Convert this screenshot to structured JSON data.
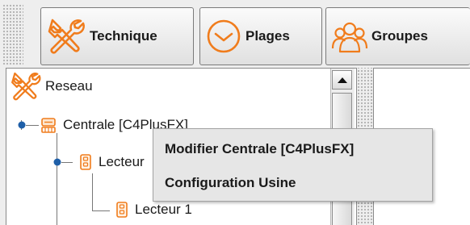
{
  "toolbar": {
    "buttons": [
      {
        "label": "Technique",
        "icon": "wrench-screwdriver-icon"
      },
      {
        "label": "Plages",
        "icon": "clock-icon"
      },
      {
        "label": "Groupes",
        "icon": "group-icon"
      }
    ],
    "accent_color": "#f07c1c"
  },
  "tree": {
    "root": {
      "label": "Reseau",
      "icon": "wrench-screwdriver-icon"
    },
    "nodes": [
      {
        "label": "Centrale [C4PlusFX]",
        "icon": "controller-icon"
      },
      {
        "label": "Lecteur",
        "icon": "reader-icon"
      },
      {
        "label": "Lecteur 1",
        "icon": "reader-icon"
      }
    ]
  },
  "context_menu": {
    "items": [
      {
        "label": "Modifier Centrale [C4PlusFX]"
      },
      {
        "label": "Configuration Usine"
      }
    ]
  }
}
